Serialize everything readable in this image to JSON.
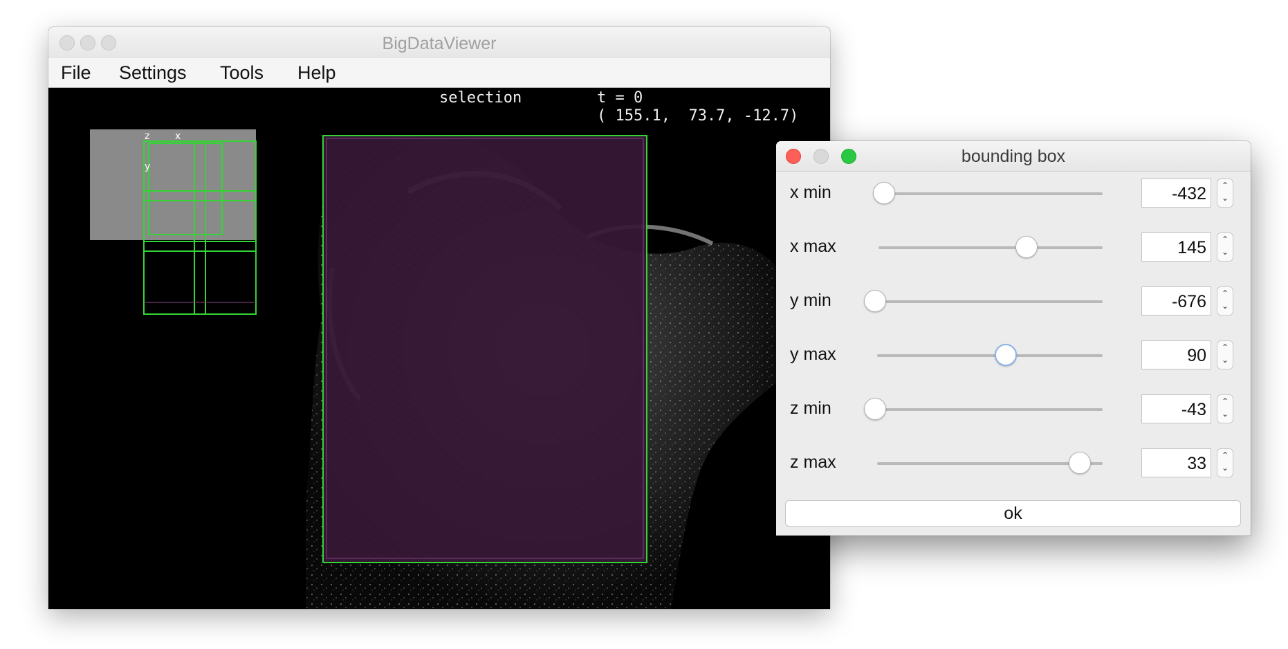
{
  "main_window": {
    "title": "BigDataViewer",
    "menu": [
      "File",
      "Settings",
      "Tools",
      "Help"
    ],
    "overlay": {
      "mode": "selection",
      "timepoint": "t = 0",
      "coords": "( 155.1,  73.7, -12.7)"
    },
    "navigator_axes": {
      "z": "z",
      "x": "x",
      "y": "y"
    },
    "colors": {
      "box_outline": "#33d633",
      "selection_fill": "#361836",
      "panel_gray": "#8a8a8a"
    }
  },
  "dialog": {
    "title": "bounding box",
    "rows": [
      {
        "label": "x min",
        "value": "-432",
        "level": 0.02
      },
      {
        "label": "x max",
        "value": "145",
        "level": 0.66
      },
      {
        "label": "y min",
        "value": "-676",
        "level": 0.02
      },
      {
        "label": "y max",
        "value": "90",
        "level": 0.57
      },
      {
        "label": "z min",
        "value": "-43",
        "level": 0.02
      },
      {
        "label": "z max",
        "value": "33",
        "level": 0.9
      }
    ],
    "ok_label": "ok",
    "traffic_colors": {
      "close": "#fc5f57",
      "minimize": "#d9d9d9",
      "zoom": "#2ac840"
    }
  }
}
